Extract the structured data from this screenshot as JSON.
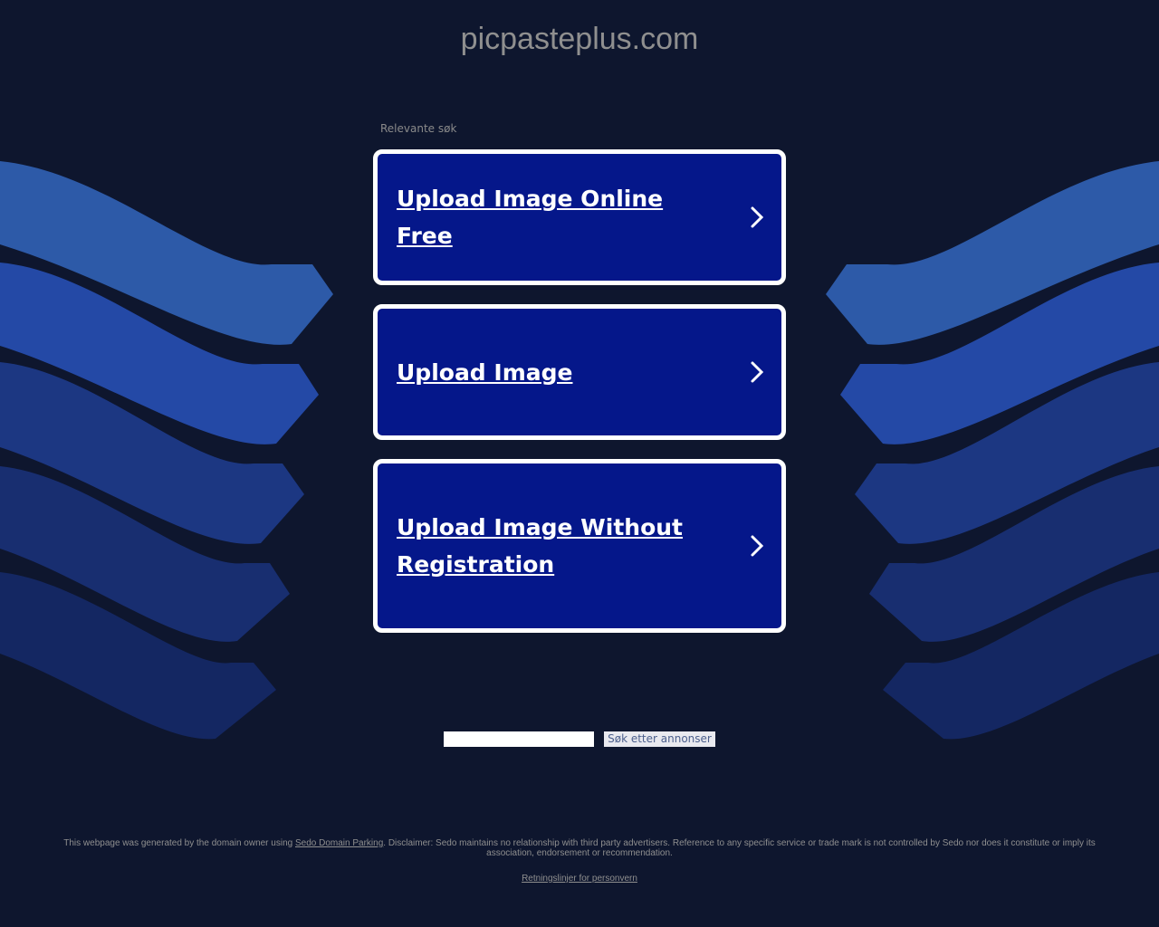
{
  "header": {
    "domain": "picpasteplus.com"
  },
  "related": {
    "label": "Relevante søk",
    "links": [
      {
        "label": "Upload Image Online Free"
      },
      {
        "label": "Upload Image"
      },
      {
        "label": "Upload Image Without Registration"
      }
    ]
  },
  "search": {
    "input_value": "",
    "button_label": "Søk etter annonser"
  },
  "footer": {
    "text_before": "This webpage was generated by the domain owner using ",
    "link_label": "Sedo Domain Parking",
    "text_after": ". Disclaimer: Sedo maintains no relationship with third party advertisers. Reference to any specific service or trade mark is not controlled by Sedo nor does it constitute or imply its association, endorsement or recommendation.",
    "privacy_label": "Retningslinjer for personvern"
  },
  "colors": {
    "background": "#0e162e",
    "card": "#05178a",
    "wave_light": "#2d5aa8",
    "wave_mid": "#2449a6",
    "wave_dark": "#1a3378"
  },
  "icons": {
    "card_arrow": "chevron-right-icon"
  }
}
